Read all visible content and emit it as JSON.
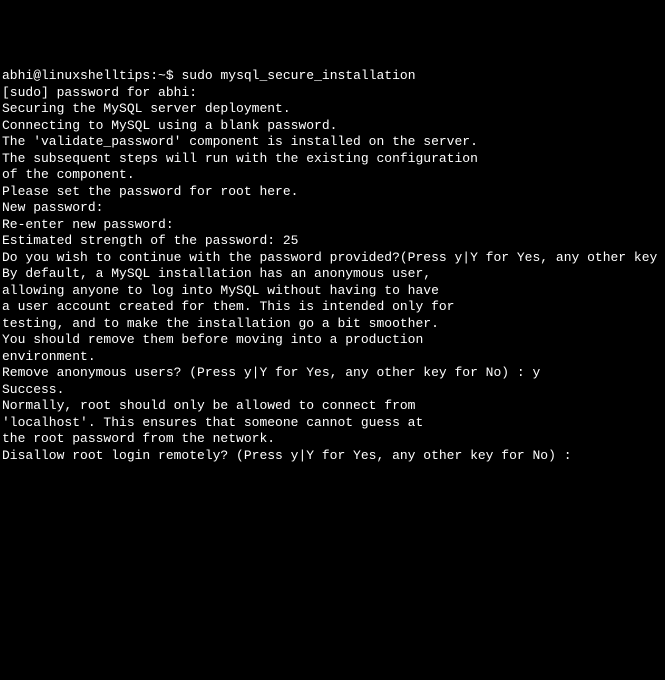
{
  "prompt": {
    "user_host": "abhi@linuxshelltips",
    "sep": ":",
    "path": "~",
    "symbol": "$ ",
    "command": "sudo mysql_secure_installation"
  },
  "lines": {
    "l01": "[sudo] password for abhi:",
    "l02": "",
    "l03": "Securing the MySQL server deployment.",
    "l04": "",
    "l05": "Connecting to MySQL using a blank password.",
    "l06": "The 'validate_password' component is installed on the server.",
    "l07": "The subsequent steps will run with the existing configuration",
    "l08": "of the component.",
    "l09": "Please set the password for root here.",
    "l10": "",
    "l11": "New password:",
    "l12": "",
    "l13": "Re-enter new password:",
    "l14": "",
    "l15": "Estimated strength of the password: 25",
    "l16": "Do you wish to continue with the password provided?(Press y|Y for Yes, any other key",
    "l17": "By default, a MySQL installation has an anonymous user,",
    "l18": "allowing anyone to log into MySQL without having to have",
    "l19": "a user account created for them. This is intended only for",
    "l20": "testing, and to make the installation go a bit smoother.",
    "l21": "You should remove them before moving into a production",
    "l22": "environment.",
    "l23": "",
    "l24": "Remove anonymous users? (Press y|Y for Yes, any other key for No) : y",
    "l25": "Success.",
    "l26": "",
    "l27": "",
    "l28": "Normally, root should only be allowed to connect from",
    "l29": "'localhost'. This ensures that someone cannot guess at",
    "l30": "the root password from the network.",
    "l31": "",
    "l32": "Disallow root login remotely? (Press y|Y for Yes, any other key for No) :"
  }
}
